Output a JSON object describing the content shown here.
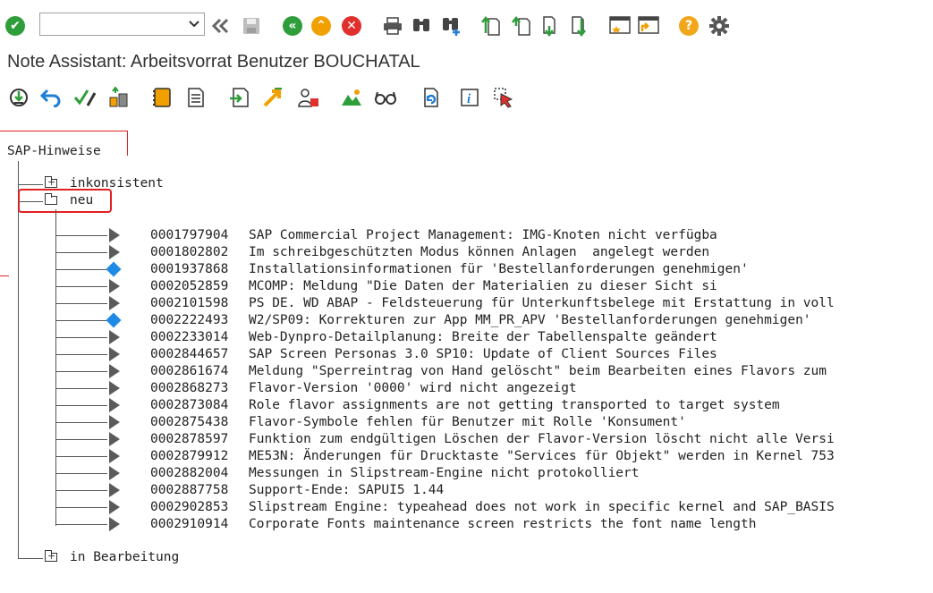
{
  "colors": {
    "accent_green": "#2e9e3a",
    "accent_orange": "#f0a000",
    "accent_red": "#e0302e",
    "help_yellow": "#f2a71b",
    "tree_arrow": "#5a5a5a",
    "tree_diamond": "#1e8ae6",
    "highlight_red": "#e02020"
  },
  "toolbar": {
    "enter_icon": "check-icon",
    "command_field": {
      "value": "",
      "placeholder": ""
    },
    "icons": [
      "check-icon",
      "collapse-icon",
      "save-icon",
      "back-icon",
      "exit-icon",
      "cancel-icon",
      "print-icon",
      "find-icon",
      "find-next-icon",
      "first-page-icon",
      "previous-page-icon",
      "next-page-icon",
      "last-page-icon",
      "create-session-icon",
      "shortcut-icon",
      "help-icon",
      "settings-icon"
    ]
  },
  "title": "Note Assistant: Arbeitsvorrat Benutzer BOUCHATAL",
  "app_toolbar": {
    "icons": [
      "download-note-icon",
      "undo-icon",
      "set-status-icon",
      "classify-icon",
      "notebook-icon",
      "list-icon",
      "export-icon",
      "jump-icon",
      "user-icon",
      "chart-icon",
      "glasses-icon",
      "refresh-icon",
      "info-icon",
      "select-cursor-icon"
    ]
  },
  "tree": {
    "root": "SAP-Hinweise",
    "folders": [
      {
        "label": "inkonsistent",
        "icon": "folder-icon"
      },
      {
        "label": "neu",
        "icon": "folder-open-icon"
      },
      {
        "label": "in Bearbeitung",
        "icon": "folder-icon"
      }
    ],
    "notes": [
      {
        "number": "0001797904",
        "text": "SAP Commercial Project Management: IMG-Knoten nicht verfügba",
        "status": "arrow"
      },
      {
        "number": "0001802802",
        "text": "Im schreibgeschützten Modus können Anlagen  angelegt werden",
        "status": "arrow"
      },
      {
        "number": "0001937868",
        "text": "Installationsinformationen für 'Bestellanforderungen genehmigen'",
        "status": "diamond"
      },
      {
        "number": "0002052859",
        "text": "MCOMP: Meldung \"Die Daten der Materialien zu dieser Sicht si",
        "status": "arrow"
      },
      {
        "number": "0002101598",
        "text": "PS DE. WD ABAP - Feldsteuerung für Unterkunftsbelege mit Erstattung in voll",
        "status": "arrow"
      },
      {
        "number": "0002222493",
        "text": "W2/SP09: Korrekturen zur App MM_PR_APV 'Bestellanforderungen genehmigen'",
        "status": "diamond"
      },
      {
        "number": "0002233014",
        "text": "Web-Dynpro-Detailplanung: Breite der Tabellenspalte geändert",
        "status": "arrow"
      },
      {
        "number": "0002844657",
        "text": "SAP Screen Personas 3.0 SP10: Update of Client Sources Files",
        "status": "arrow"
      },
      {
        "number": "0002861674",
        "text": "Meldung \"Sperreintrag von Hand gelöscht\" beim Bearbeiten eines Flavors zum",
        "status": "arrow"
      },
      {
        "number": "0002868273",
        "text": "Flavor-Version '0000' wird nicht angezeigt",
        "status": "arrow"
      },
      {
        "number": "0002873084",
        "text": "Role flavor assignments are not getting transported to target system",
        "status": "arrow"
      },
      {
        "number": "0002875438",
        "text": "Flavor-Symbole fehlen für Benutzer mit Rolle 'Konsument'",
        "status": "arrow"
      },
      {
        "number": "0002878597",
        "text": "Funktion zum endgültigen Löschen der Flavor-Version löscht nicht alle Versi",
        "status": "arrow"
      },
      {
        "number": "0002879912",
        "text": "ME53N: Änderungen für Drucktaste \"Services für Objekt\" werden in Kernel 753",
        "status": "arrow"
      },
      {
        "number": "0002882004",
        "text": "Messungen in Slipstream-Engine nicht protokolliert",
        "status": "arrow"
      },
      {
        "number": "0002887758",
        "text": "Support-Ende: SAPUI5 1.44",
        "status": "arrow"
      },
      {
        "number": "0002902853",
        "text": "Slipstream Engine: typeahead does not work in specific kernel and SAP_BASIS",
        "status": "arrow"
      },
      {
        "number": "0002910914",
        "text": "Corporate Fonts maintenance screen restricts the font name length",
        "status": "arrow"
      }
    ]
  }
}
